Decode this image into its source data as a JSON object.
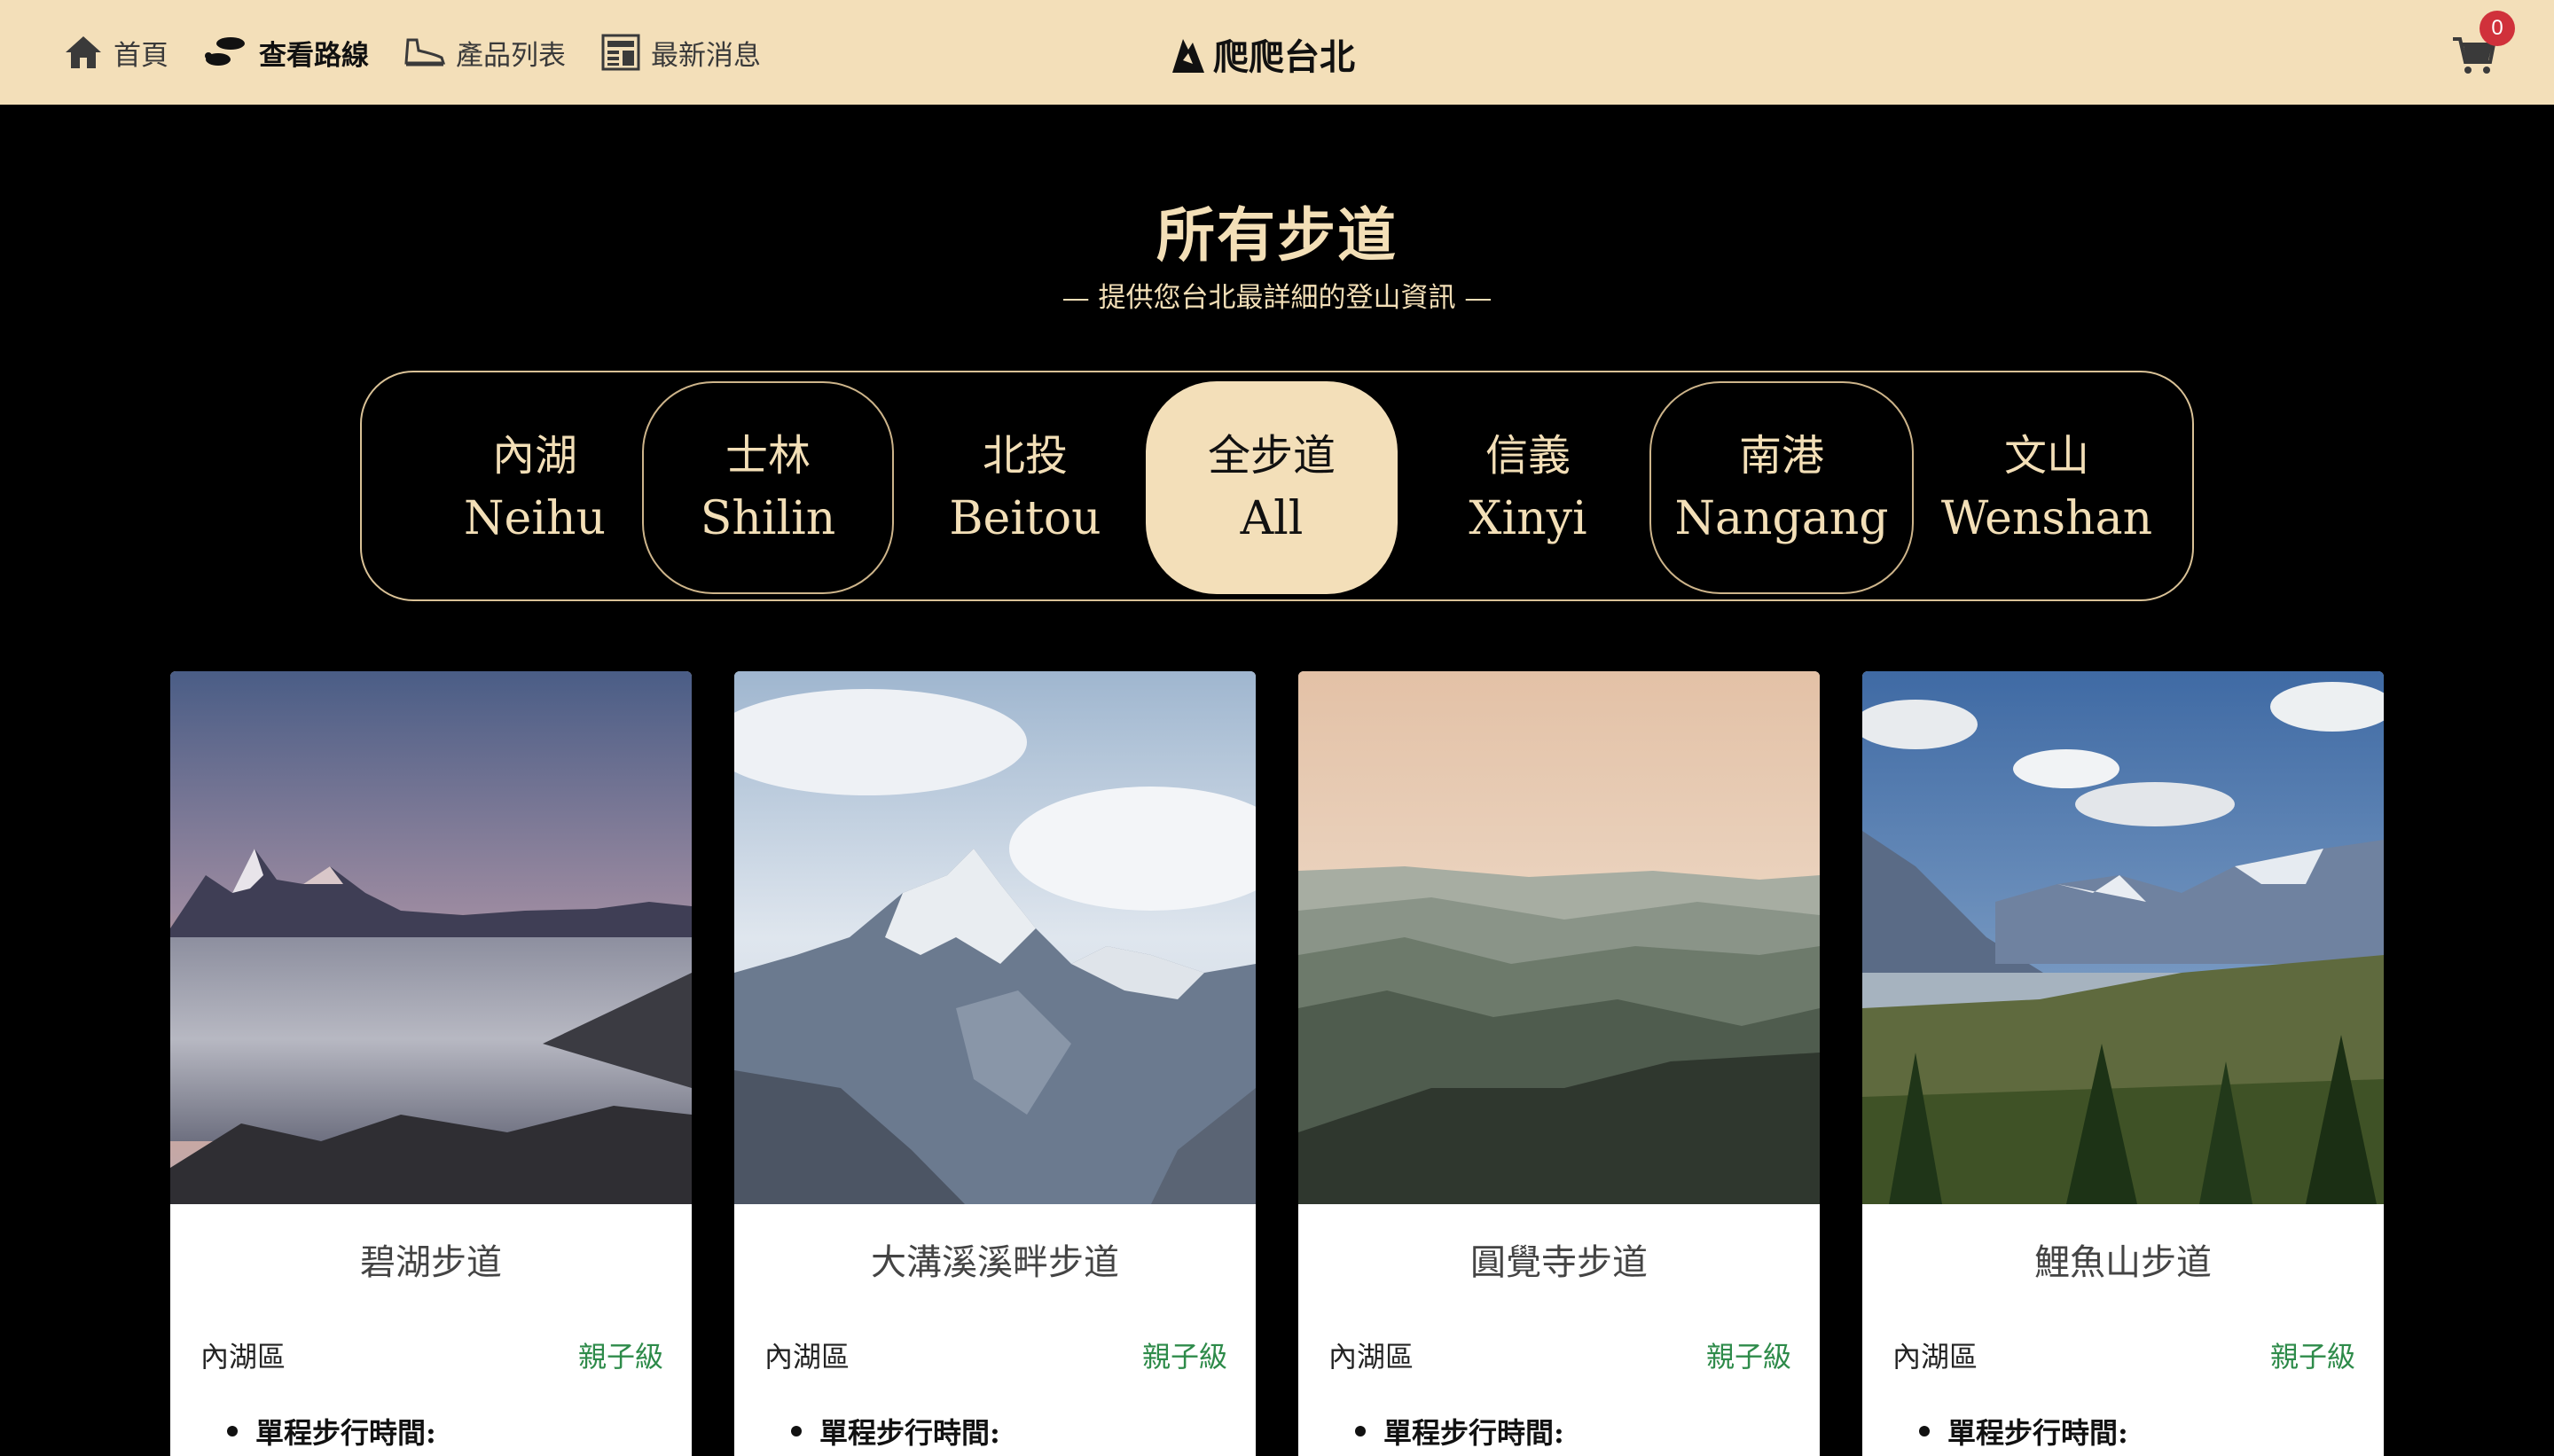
{
  "nav": {
    "items": [
      {
        "label": "首頁",
        "icon": "home-icon",
        "active": false
      },
      {
        "label": "查看路線",
        "icon": "footprints-icon",
        "active": true
      },
      {
        "label": "產品列表",
        "icon": "sneaker-icon",
        "active": false
      },
      {
        "label": "最新消息",
        "icon": "newspaper-icon",
        "active": false
      }
    ],
    "brand": "爬爬台北",
    "cart_count": "0"
  },
  "header": {
    "title": "所有步道",
    "subtitle": "— 提供您台北最詳細的登山資訊 —"
  },
  "filters": [
    {
      "zh": "內湖",
      "en": "Neihu",
      "state": "plain"
    },
    {
      "zh": "士林",
      "en": "Shilin",
      "state": "outlined"
    },
    {
      "zh": "北投",
      "en": "Beitou",
      "state": "plain"
    },
    {
      "zh": "全步道",
      "en": "All",
      "state": "active"
    },
    {
      "zh": "信義",
      "en": "Xinyi",
      "state": "plain"
    },
    {
      "zh": "南港",
      "en": "Nangang",
      "state": "outlined"
    },
    {
      "zh": "文山",
      "en": "Wenshan",
      "state": "plain"
    }
  ],
  "cards": [
    {
      "title": "碧湖步道",
      "district": "內湖區",
      "level": "親子級",
      "info_label": "單程步行時間:"
    },
    {
      "title": "大溝溪溪畔步道",
      "district": "內湖區",
      "level": "親子級",
      "info_label": "單程步行時間:"
    },
    {
      "title": "圓覺寺步道",
      "district": "內湖區",
      "level": "親子級",
      "info_label": "單程步行時間:"
    },
    {
      "title": "鯉魚山步道",
      "district": "內湖區",
      "level": "親子級",
      "info_label": "單程步行時間:"
    }
  ],
  "colors": {
    "nav_bg": "#f3dfb9",
    "accent": "#f3dfb7",
    "page_bg": "#000000",
    "level_green": "#2e8b4a",
    "badge_red": "#d0313b"
  }
}
